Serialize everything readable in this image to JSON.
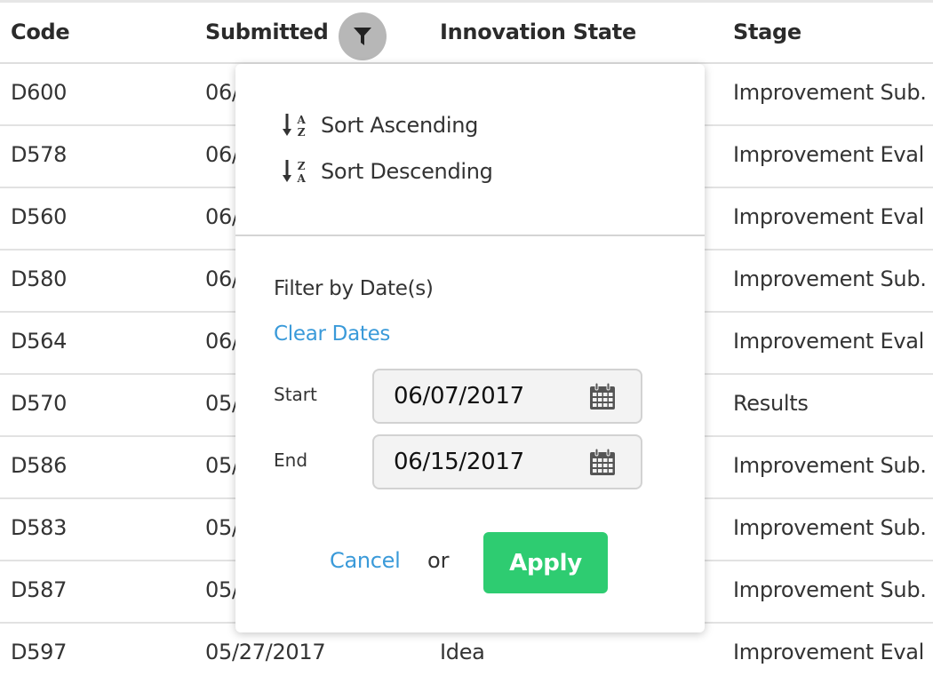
{
  "table": {
    "headers": {
      "code": "Code",
      "submitted": "Submitted",
      "innovation_state": "Innovation State",
      "stage": "Stage"
    },
    "filter_icon": "filter-icon",
    "rows": [
      {
        "code": "D600",
        "submitted": "06/",
        "state": "",
        "stage": "Improvement Sub."
      },
      {
        "code": "D578",
        "submitted": "06/",
        "state": "",
        "stage": "Improvement Eval"
      },
      {
        "code": "D560",
        "submitted": "06/",
        "state": "",
        "stage": "Improvement Eval"
      },
      {
        "code": "D580",
        "submitted": "06/",
        "state": "",
        "stage": "Improvement Sub."
      },
      {
        "code": "D564",
        "submitted": "06/",
        "state": "",
        "stage": "Improvement Eval"
      },
      {
        "code": "D570",
        "submitted": "05/",
        "state": "",
        "stage": "Results"
      },
      {
        "code": "D586",
        "submitted": "05/",
        "state": "",
        "stage": "Improvement Sub."
      },
      {
        "code": "D583",
        "submitted": "05/",
        "state": "",
        "stage": "Improvement Sub."
      },
      {
        "code": "D587",
        "submitted": "05/",
        "state": "",
        "stage": "Improvement Sub."
      },
      {
        "code": "D597",
        "submitted": "05/27/2017",
        "state": "Idea",
        "stage": "Improvement Eval"
      }
    ]
  },
  "popover": {
    "sort_ascending": {
      "label": "Sort Ascending",
      "icon": "sort-alpha-asc-icon"
    },
    "sort_descending": {
      "label": "Sort Descending",
      "icon": "sort-alpha-desc-icon"
    },
    "filter_title": "Filter by Date(s)",
    "clear_dates": "Clear Dates",
    "start": {
      "label": "Start",
      "value": "06/07/2017",
      "icon": "calendar-icon"
    },
    "end": {
      "label": "End",
      "value": "06/15/2017",
      "icon": "calendar-icon"
    },
    "cancel": "Cancel",
    "or": "or",
    "apply": "Apply"
  },
  "colors": {
    "link": "#3a9ad9",
    "apply": "#2ecc71",
    "filter_button": "#b7b7b7"
  }
}
